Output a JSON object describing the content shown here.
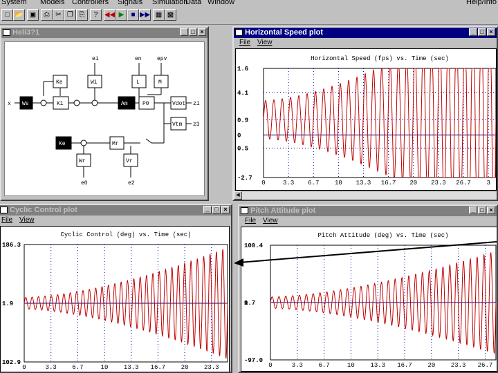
{
  "menubar": [
    "System",
    "Models",
    "Controllers",
    "Signals",
    "Simulation",
    "Data",
    "Window",
    "Help/Info"
  ],
  "toolbar_icons": [
    "new-icon",
    "open-icon",
    "save-icon",
    "print-icon",
    "cut-icon",
    "copy-icon",
    "paste-icon",
    "help-icon",
    "rewind-icon",
    "play-icon",
    "stop-icon",
    "fast-forward-icon",
    "graph-icon",
    "layout-icon"
  ],
  "heli": {
    "title": "Heli3?1",
    "blocks": {
      "ke": "Ke",
      "wi": "Wi",
      "l": "L",
      "m": "M",
      "k1": "K1",
      "ws": "Ws",
      "am": "Am",
      "p0": "P0",
      "ke2": "Ke",
      "mr": "Mr",
      "wr": "Wr",
      "vr": "Vr",
      "vdot": "Vdot",
      "vtm": "Vtm"
    },
    "labels": {
      "e1": "e1",
      "en": "en",
      "epv": "epv",
      "x": "x",
      "z1": "z1",
      "z3": "z3",
      "e0": "e0",
      "e2": "e2"
    }
  },
  "hspeed": {
    "title": "Horizontal Speed plot",
    "menu": [
      "File",
      "View"
    ],
    "chart_data": {
      "type": "line",
      "title": "Horizontal Speed (fps) vs. Time (sec)",
      "x_ticks": [
        "0",
        "3.3",
        "6.7",
        "10",
        "13.3",
        "16.7",
        "20",
        "23.3",
        "26.7",
        "3"
      ],
      "y_ticks": [
        "1.6",
        "4.1",
        "0.9",
        "0",
        "0.5",
        "-2.7"
      ],
      "xlim": [
        0,
        30
      ],
      "ylim": [
        -2.7,
        1.6
      ],
      "series": [
        {
          "type": "growing-oscillation",
          "color": "#c00000",
          "start_amplitude": 0.35,
          "end_amplitude": 2.2,
          "cycles": 28
        },
        {
          "type": "reference",
          "color": "#000080",
          "value": 0.0
        }
      ]
    }
  },
  "cyclic": {
    "title": "Cyclic Control plot",
    "menu": [
      "File",
      "View"
    ],
    "chart_data": {
      "type": "line",
      "title": "Cyclic Control (deg) vs. Time (sec)",
      "x_ticks": [
        "0",
        "3.3",
        "6.7",
        "10",
        "13.3",
        "16.7",
        "20",
        "23.3"
      ],
      "y_ticks": [
        "186.3",
        "1.9",
        "102.9"
      ],
      "xlim": [
        0,
        26.7
      ],
      "series": [
        {
          "type": "growing-oscillation",
          "color": "#c00000",
          "start_amplitude": 0.1,
          "end_amplitude": 0.95,
          "cycles": 32
        },
        {
          "type": "reference",
          "color": "#000080",
          "value": 0.0
        }
      ]
    }
  },
  "pitch": {
    "title": "Pitch Attitude plot",
    "menu": [
      "File",
      "View"
    ],
    "chart_data": {
      "type": "line",
      "title": "Pitch Attitude (deg) vs. Time (sec)",
      "x_ticks": [
        "0",
        "3.3",
        "6.7",
        "10",
        "13.3",
        "16.7",
        "20",
        "23.3",
        "26.7"
      ],
      "y_ticks": [
        "100.4",
        "1.7",
        "-97.0"
      ],
      "y_left_label": "0",
      "xlim": [
        0,
        30
      ],
      "series": [
        {
          "type": "growing-oscillation",
          "color": "#c00000",
          "start_amplitude": 0.1,
          "end_amplitude": 0.9,
          "cycles": 33
        },
        {
          "type": "reference",
          "color": "#000080",
          "value": 0.0
        }
      ]
    }
  }
}
